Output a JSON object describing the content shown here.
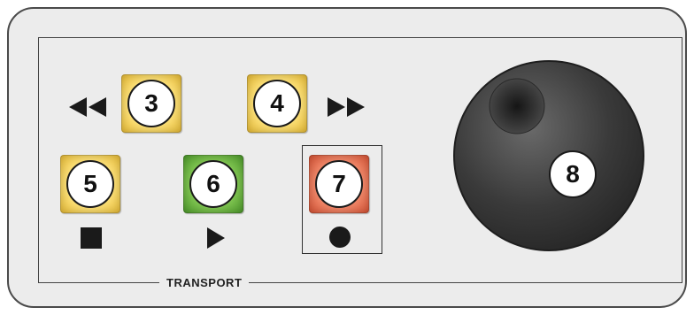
{
  "panel": {
    "label": "TRANSPORT"
  },
  "buttons": {
    "rewind": {
      "number": "3",
      "symbol": "rewind-icon",
      "color": "yellow"
    },
    "forward": {
      "number": "4",
      "symbol": "fast-forward-icon",
      "color": "yellow"
    },
    "stop": {
      "number": "5",
      "symbol": "stop-icon",
      "color": "yellow"
    },
    "play": {
      "number": "6",
      "symbol": "play-icon",
      "color": "green"
    },
    "record": {
      "number": "7",
      "symbol": "record-icon",
      "color": "red"
    }
  },
  "jog_wheel": {
    "number": "8"
  },
  "colors": {
    "yellow": "#fbe07a",
    "green": "#82c653",
    "red": "#f08a6c",
    "wheel": "#3a3a3a"
  }
}
